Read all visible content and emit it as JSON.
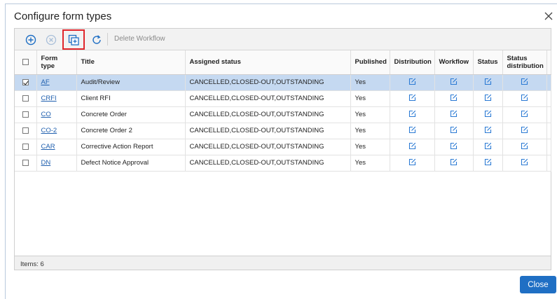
{
  "dialog": {
    "title": "Configure form types",
    "close_button_label": "Close"
  },
  "toolbar": {
    "delete_workflow_label": "Delete Workflow",
    "icons": [
      "add-circle-icon",
      "remove-circle-icon",
      "copy-add-icon",
      "refresh-icon"
    ]
  },
  "grid": {
    "columns": [
      "Form type",
      "Title",
      "Assigned status",
      "Published",
      "Distribution",
      "Workflow",
      "Status",
      "Status distribution"
    ],
    "rows": [
      {
        "form_type": "AF",
        "title": "Audit/Review",
        "assigned_status": "CANCELLED,CLOSED-OUT,OUTSTANDING",
        "published": "Yes",
        "checked": true
      },
      {
        "form_type": "CRFI",
        "title": "Client RFI",
        "assigned_status": "CANCELLED,CLOSED-OUT,OUTSTANDING",
        "published": "Yes",
        "checked": false
      },
      {
        "form_type": "CO",
        "title": "Concrete Order",
        "assigned_status": "CANCELLED,CLOSED-OUT,OUTSTANDING",
        "published": "Yes",
        "checked": false
      },
      {
        "form_type": "CO-2",
        "title": "Concrete Order 2",
        "assigned_status": "CANCELLED,CLOSED-OUT,OUTSTANDING",
        "published": "Yes",
        "checked": false
      },
      {
        "form_type": "CAR",
        "title": "Corrective Action Report",
        "assigned_status": "CANCELLED,CLOSED-OUT,OUTSTANDING",
        "published": "Yes",
        "checked": false
      },
      {
        "form_type": "DN",
        "title": "Defect Notice Approval",
        "assigned_status": "CANCELLED,CLOSED-OUT,OUTSTANDING",
        "published": "Yes",
        "checked": false
      }
    ]
  },
  "footer": {
    "items_label": "Items: 6"
  },
  "colors": {
    "accent": "#1f6fc4",
    "selected_row": "#c5d9f1",
    "highlight_box": "#e0262c",
    "link": "#1f5fae"
  }
}
